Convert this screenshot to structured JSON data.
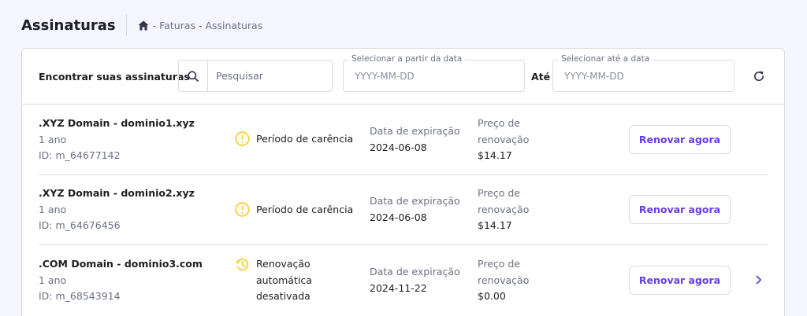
{
  "header": {
    "title": "Assinaturas",
    "breadcrumb": [
      "- Faturas",
      "- Assinaturas"
    ]
  },
  "filters": {
    "label": "Encontrar suas assinaturas",
    "search_placeholder": "Pesquisar",
    "from_label": "Selecionar a partir da data",
    "from_placeholder": "YYYY-MM-DD",
    "until_label": "Até",
    "to_label": "Selecionar até a data",
    "to_placeholder": "YYYY-MM-DD"
  },
  "subscriptions": [
    {
      "name": ".XYZ Domain - dominio1.xyz",
      "period": "1 ano",
      "id": "ID: m_64677142",
      "status_lines": [
        "Período de carência"
      ],
      "status_icon": "warning-circle-icon",
      "exp_label": "Data de expiração",
      "exp_date": "2024-06-08",
      "price_label_1": "Preço de",
      "price_label_2": "renovação",
      "price": "$14.17",
      "button": "Renovar agora"
    },
    {
      "name": ".XYZ Domain - dominio2.xyz",
      "period": "1 ano",
      "id": "ID: m_64676456",
      "status_lines": [
        "Período de carência"
      ],
      "status_icon": "warning-circle-icon",
      "exp_label": "Data de expiração",
      "exp_date": "2024-06-08",
      "price_label_1": "Preço de",
      "price_label_2": "renovação",
      "price": "$14.17",
      "button": "Renovar agora"
    },
    {
      "name": ".COM Domain - dominio3.com",
      "period": "1 ano",
      "id": "ID: m_68543914",
      "status_lines": [
        "Renovação",
        "automática",
        "desativada"
      ],
      "status_icon": "history-icon",
      "exp_label": "Data de expiração",
      "exp_date": "2024-11-22",
      "price_label_1": "Preço de",
      "price_label_2": "renovação",
      "price": "$0.00",
      "button": "Renovar agora"
    }
  ],
  "colors": {
    "accent": "#673de6",
    "warning": "#ffcd35",
    "background": "#f4f5ff"
  }
}
